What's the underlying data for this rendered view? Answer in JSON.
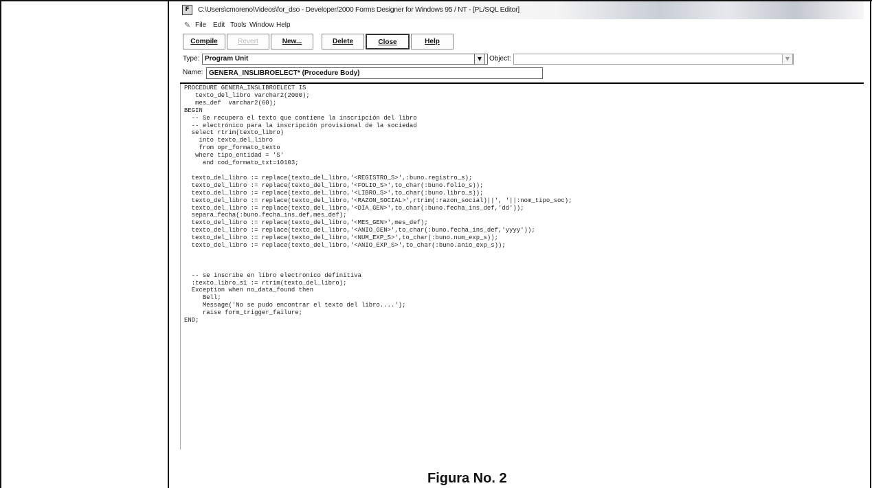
{
  "window": {
    "title": "C:\\Users\\cmoreno\\Videos\\for_dso - Developer/2000 Forms Designer for Windows 95 / NT - [PL/SQL Editor]",
    "app_icon": "forms-app-icon"
  },
  "menu": {
    "icon": "forms-menu-icon",
    "items": [
      "File",
      "Edit",
      "Tools",
      "Window",
      "Help"
    ]
  },
  "toolbar": {
    "compile": "Compile",
    "revert": "Revert",
    "new": "New...",
    "delete": "Delete",
    "close": "Close",
    "help": "Help"
  },
  "fields": {
    "type_label": "Type:",
    "type_value": "Program Unit",
    "object_label": "Object:",
    "object_value": "",
    "name_label": "Name:",
    "name_value": "GENERA_INSLIBROELECT* (Procedure Body)"
  },
  "code_lines": [
    "PROCEDURE GENERA_INSLIBROELECT IS",
    "   texto_del_libro varchar2(2000);",
    "   mes_def  varchar2(60);",
    "BEGIN",
    "  -- Se recupera el texto que contiene la inscripción del libro",
    "  -- electrónico para la inscripción provisional de la sociedad",
    "  select rtrim(texto_libro)",
    "    into texto_del_libro",
    "    from opr_formato_texto",
    "   where tipo_entidad = 'S'",
    "     and cod_formato_txt=10103;",
    "",
    "  texto_del_libro := replace(texto_del_libro,'<REGISTRO_S>',:buno.registro_s);",
    "  texto_del_libro := replace(texto_del_libro,'<FOLIO_S>',to_char(:buno.folio_s));",
    "  texto_del_libro := replace(texto_del_libro,'<LIBRO_S>',to_char(:buno.libro_s));",
    "  texto_del_libro := replace(texto_del_libro,'<RAZON_SOCIAL>',rtrim(:razon_social)||', '||:nom_tipo_soc);",
    "  texto_del_libro := replace(texto_del_libro,'<DIA_GEN>',to_char(:buno.fecha_ins_def,'dd'));",
    "  separa_fecha(:buno.fecha_ins_def,mes_def);",
    "  texto_del_libro := replace(texto_del_libro,'<MES_GEN>',mes_def);",
    "  texto_del_libro := replace(texto_del_libro,'<ANIO_GEN>',to_char(:buno.fecha_ins_def,'yyyy'));",
    "  texto_del_libro := replace(texto_del_libro,'<NUM_EXP_S>',to_char(:buno.num_exp_s));",
    "  texto_del_libro := replace(texto_del_libro,'<ANIO_EXP_S>',to_char(:buno.anio_exp_s));",
    "",
    "",
    "",
    "  -- se inscribe en libro electronico definitiva",
    "  :texto_libro_s1 := rtrim(texto_del_libro);",
    "  Exception when no_data_found then",
    "     Bell;",
    "     Message('No se pudo encontrar el texto del libro....');",
    "     raise form_trigger_failure;",
    "END;"
  ],
  "caption": "Figura No. 2"
}
